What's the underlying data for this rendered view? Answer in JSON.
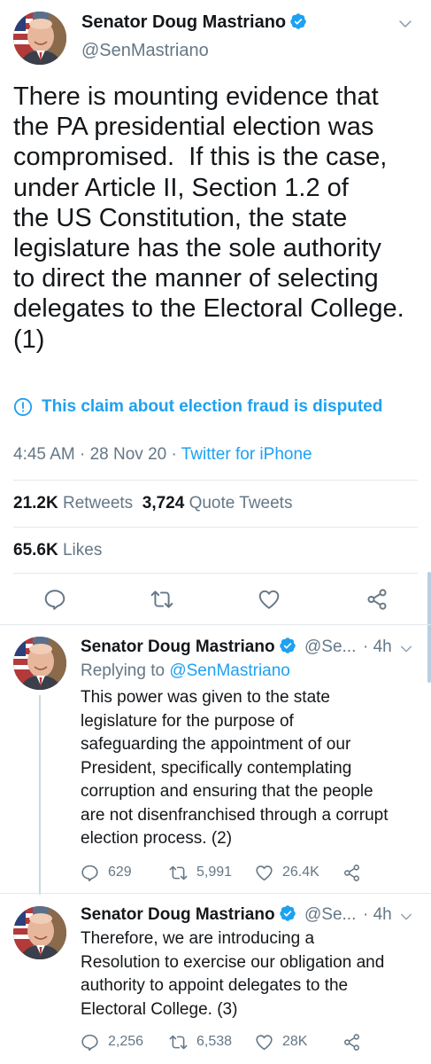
{
  "main": {
    "name": "Senator Doug Mastriano",
    "handle": "@SenMastriano",
    "text": "There is mounting evidence that\nthe PA presidential election was\ncompromised.  If this is the case,\nunder Article II, Section 1.2 of\nthe US Constitution, the state\nlegislature has the sole authority\nto direct the manner of selecting\ndelegates to the Electoral College.\n(1)",
    "notice": "This claim about election fraud is disputed",
    "time": "4:45 AM · 28 Nov 20 · ",
    "source": "Twitter for iPhone",
    "retweets_count": "21.2K",
    "retweets_label": "Retweets",
    "quotes_count": "3,724",
    "quotes_label": "Quote Tweets",
    "likes_count": "65.6K",
    "likes_label": "Likes"
  },
  "replies": [
    {
      "name": "Senator Doug Mastriano",
      "handle": "@Se...",
      "time": "· 4h",
      "replying_label": "Replying to ",
      "replying_to": "@SenMastriano",
      "text": "This power was given to the state\nlegislature for the purpose of\nsafeguarding the appointment of our\nPresident, specifically contemplating\ncorruption and ensuring that the people\nare not disenfranchised through a corrupt\nelection process. (2)",
      "replies": "629",
      "retweets": "5,991",
      "likes": "26.4K"
    },
    {
      "name": "Senator Doug Mastriano",
      "handle": "@Se...",
      "time": "· 4h",
      "text": "Therefore, we are introducing a\nResolution to exercise our obligation and\nauthority to appoint delegates to the\nElectoral College. (3)",
      "replies": "2,256",
      "retweets": "6,538",
      "likes": "28K"
    }
  ],
  "colors": {
    "accent": "#1da1f2",
    "text": "#14171a",
    "muted": "#657786",
    "border": "#e1e8ed"
  },
  "icons": [
    "verified-badge-icon",
    "chevron-down-icon",
    "info-circle-icon",
    "reply-icon",
    "retweet-icon",
    "heart-icon",
    "share-icon"
  ]
}
